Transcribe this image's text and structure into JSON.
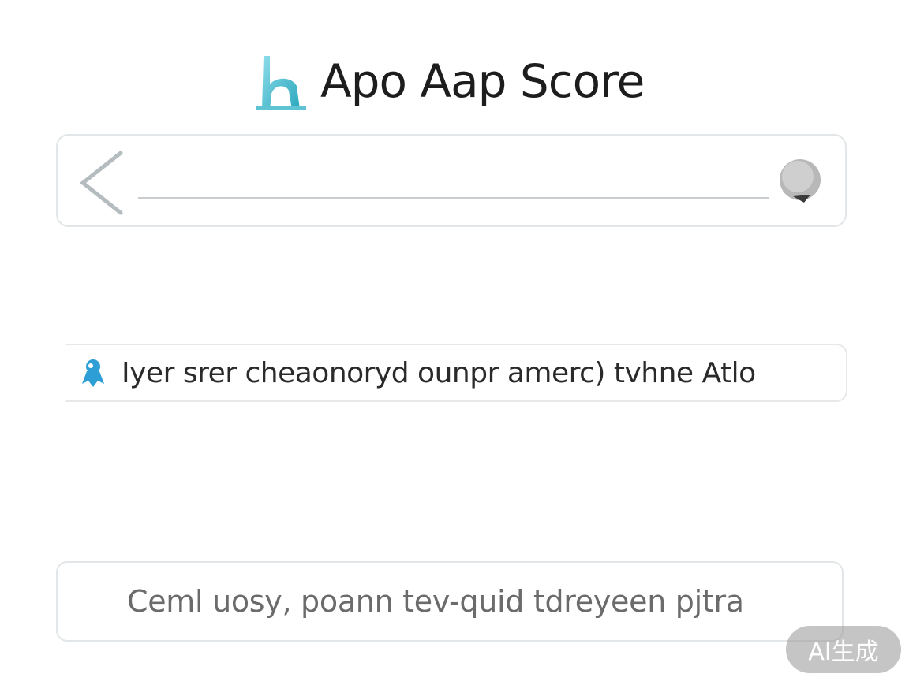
{
  "header": {
    "logo_icon": "h-logo-icon",
    "title": "Apo Aap Score"
  },
  "top_bar": {
    "back_icon": "chevron-left-icon",
    "knob_icon": "gray-circle-knob"
  },
  "notice": {
    "icon": "blue-figure-icon",
    "text": "Iyer srer cheaonoryd ounpr amerc) tvhne Atlo"
  },
  "bottom_card": {
    "text": "Ceml uosy, poann tev-quid tdreyeen pjtra"
  },
  "badge": {
    "text": "AI生成"
  },
  "colors": {
    "logo_teal": "#3bb7c9",
    "logo_blue": "#7fd3e6",
    "border": "#e3e6e8",
    "knob": "#b4b4b4"
  }
}
